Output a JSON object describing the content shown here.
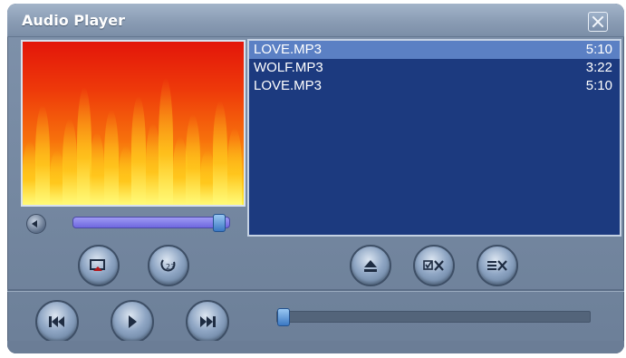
{
  "window": {
    "title": "Audio Player"
  },
  "controls": {
    "close_icon": "close-icon",
    "volume_level": 0.96,
    "seek_position": 0.0
  },
  "playlist": {
    "tracks": [
      {
        "name": "LOVE.MP3",
        "duration": "5:10",
        "selected": true
      },
      {
        "name": "WOLF.MP3",
        "duration": "3:22",
        "selected": false
      },
      {
        "name": "LOVE.MP3",
        "duration": "5:10",
        "selected": false
      }
    ]
  },
  "buttons": {
    "repeat": "repeat-icon",
    "shuffle": "shuffle-icon",
    "eject": "eject-icon",
    "remove_selected": "remove-selected-icon",
    "clear_list": "clear-list-icon",
    "previous": "previous-track-icon",
    "play": "play-icon",
    "next": "next-track-icon"
  },
  "colors": {
    "playlist_bg": "#1c3a7f",
    "selected_row": "#5b80c4",
    "window": "#7f92ab"
  }
}
